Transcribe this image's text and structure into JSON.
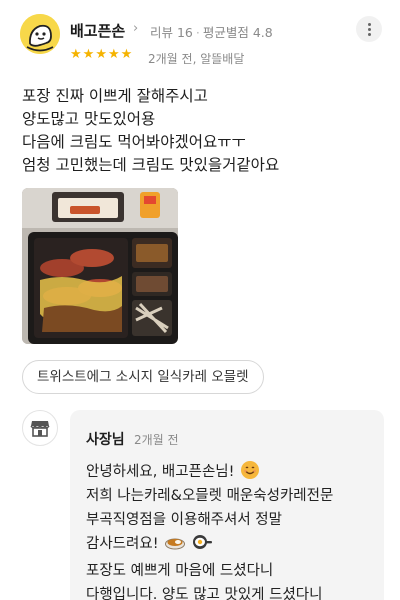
{
  "review": {
    "nickname": "배고픈손",
    "review_count": "리뷰 16",
    "avg_rating": "평균별점 4.8",
    "meta_separator": "·",
    "rating": 5,
    "rating_max": 5,
    "date_delivery": "2개월 전, 알뜰배달",
    "text_lines": [
      "포장 진짜 이쁘게 잘해주시고",
      "양도많고 맛도있어용",
      "다음에 크림도 먹어봐야겠어요ㅠㅜ",
      "엄청 고민했는데 크림도 맛있을거같아요"
    ]
  },
  "menu_tag": "트위스트에그 소시지 일식카레 오믈렛",
  "owner": {
    "name": "사장님",
    "date": "2개월 전",
    "reply_lines": [
      "안녕하세요, 배고픈손님!",
      "저희 나는카레&오믈렛 매운숙성카레전문",
      "부곡직영점을 이용해주셔서 정말",
      "감사드려요!",
      "포장도 예쁘게 마음에 드셨다니",
      "다행입니다. 양도 많고 맛있게 드셨다니"
    ]
  },
  "colors": {
    "star": "#f5b300",
    "avatar_bg": "#f7d84a",
    "reply_bg": "#f4f4f4",
    "meta_text": "#8a8a8a"
  },
  "icons": {
    "more": "more-vertical-icon",
    "profile": "duck-avatar-icon",
    "store": "store-icon",
    "star": "star-icon"
  }
}
